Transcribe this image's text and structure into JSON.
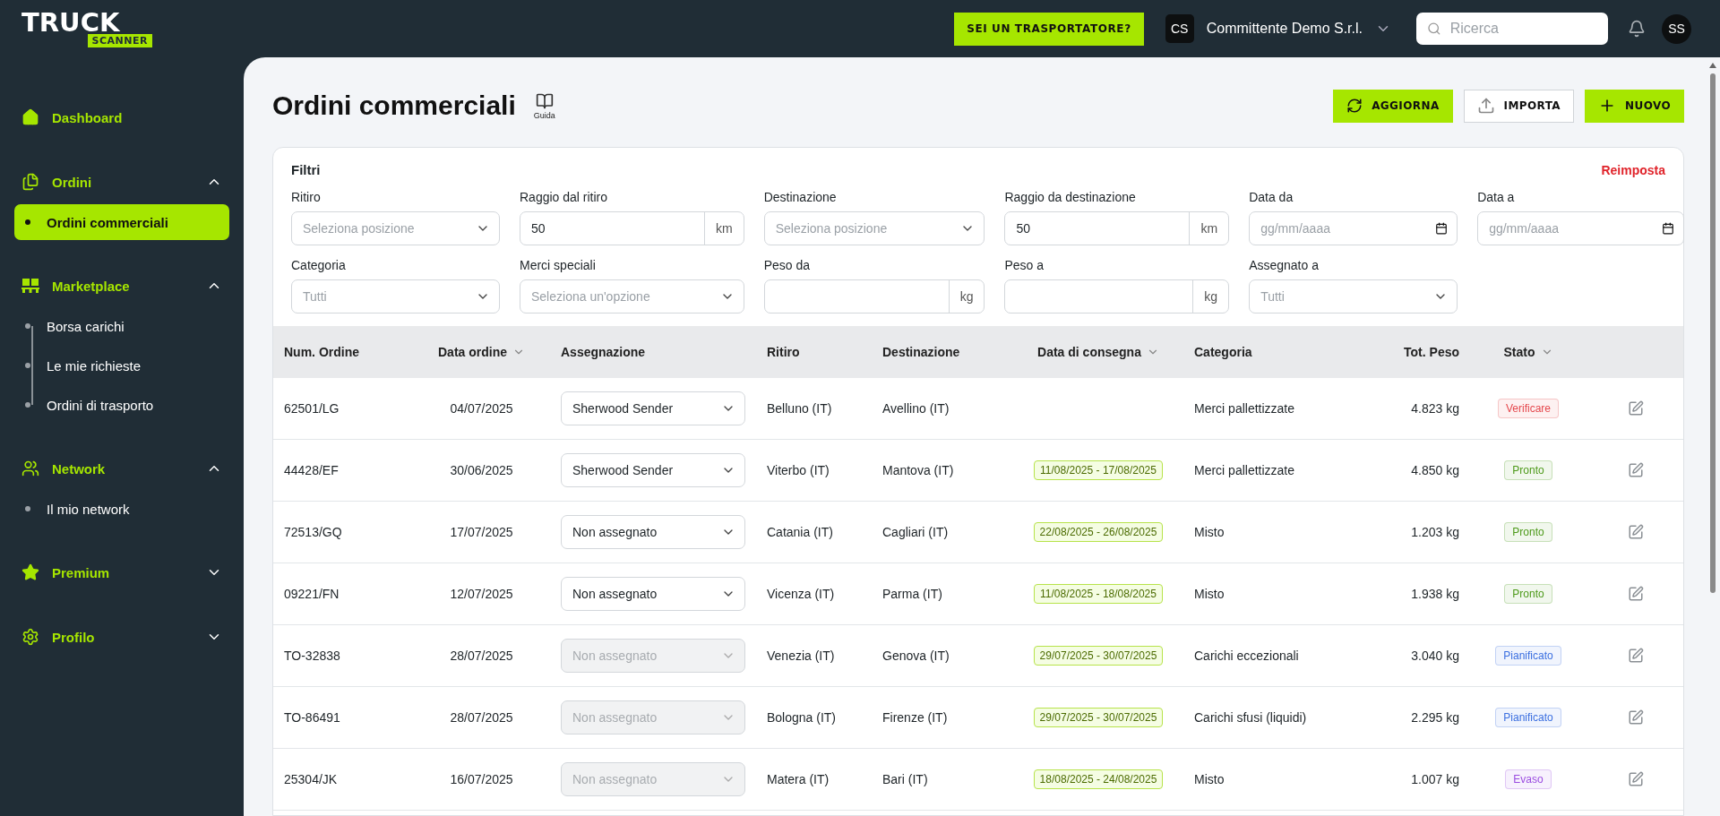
{
  "logo": {
    "word": "TRUCK",
    "tag": "SCANNER"
  },
  "topbar": {
    "carrier_button": "SEI UN TRASPORTATORE?",
    "company": {
      "initials": "CS",
      "name": "Committente Demo S.r.l."
    },
    "search": {
      "placeholder": "Ricerca"
    },
    "user_initials": "SS"
  },
  "sidebar": [
    {
      "label": "Dashboard",
      "kind": "link"
    },
    {
      "label": "Ordini",
      "kind": "group",
      "expanded": true,
      "children": [
        {
          "label": "Ordini commerciali",
          "selected": true
        }
      ]
    },
    {
      "label": "Marketplace",
      "kind": "group",
      "expanded": true,
      "children": [
        {
          "label": "Borsa carichi",
          "selected": false
        },
        {
          "label": "Le mie richieste",
          "selected": false
        },
        {
          "label": "Ordini di trasporto",
          "selected": false
        }
      ]
    },
    {
      "label": "Network",
      "kind": "group",
      "expanded": true,
      "children": [
        {
          "label": "Il mio network",
          "selected": false
        }
      ]
    },
    {
      "label": "Premium",
      "kind": "group",
      "expanded": false
    },
    {
      "label": "Profilo",
      "kind": "group",
      "expanded": false
    }
  ],
  "page": {
    "title": "Ordini commerciali",
    "guide": "Guida",
    "actions": [
      {
        "label": "AGGIORNA",
        "kind": "refresh"
      },
      {
        "label": "IMPORTA",
        "kind": "import"
      },
      {
        "label": "NUOVO",
        "kind": "new"
      }
    ]
  },
  "filters": {
    "title": "Filtri",
    "reset": "Reimposta",
    "fields": [
      {
        "label": "Ritiro",
        "kind": "select",
        "placeholder": "Seleziona posizione"
      },
      {
        "label": "Raggio dal ritiro",
        "kind": "unit",
        "value": "50",
        "unit": "km"
      },
      {
        "label": "Destinazione",
        "kind": "select",
        "placeholder": "Seleziona posizione"
      },
      {
        "label": "Raggio da destinazione",
        "kind": "unit",
        "value": "50",
        "unit": "km"
      },
      {
        "label": "Data da",
        "kind": "date",
        "placeholder": "gg/mm/aaaa"
      },
      {
        "label": "Data a",
        "kind": "date",
        "placeholder": "gg/mm/aaaa"
      },
      {
        "label": "Categoria",
        "kind": "select",
        "placeholder": "Tutti"
      },
      {
        "label": "Merci speciali",
        "kind": "select",
        "placeholder": "Seleziona un'opzione"
      },
      {
        "label": "Peso da",
        "kind": "unit",
        "unit": "kg"
      },
      {
        "label": "Peso a",
        "kind": "unit",
        "unit": "kg"
      },
      {
        "label": "Assegnato a",
        "kind": "select",
        "placeholder": "Tutti"
      }
    ]
  },
  "table": {
    "columns": [
      {
        "label": "Num. Ordine"
      },
      {
        "label": "Data ordine",
        "sortable": true
      },
      {
        "label": "Assegnazione"
      },
      {
        "label": "Ritiro"
      },
      {
        "label": "Destinazione"
      },
      {
        "label": "Data di consegna",
        "sortable": true
      },
      {
        "label": "Categoria"
      },
      {
        "label": "Tot. Peso"
      },
      {
        "label": "Stato",
        "sortable": true
      }
    ],
    "rows": [
      {
        "order": "62501/LG",
        "date": "04/07/2025",
        "assignee": {
          "value": "Sherwood Sender",
          "disabled": false
        },
        "pickup": "Belluno (IT)",
        "destination": "Avellino (IT)",
        "category": "Merci pallettizzate",
        "weight": "4.823 kg",
        "status": {
          "label": "Verificare",
          "color": "#e5484d"
        }
      },
      {
        "order": "44428/EF",
        "date": "30/06/2025",
        "assignee": {
          "value": "Sherwood Sender",
          "disabled": false
        },
        "pickup": "Viterbo (IT)",
        "destination": "Mantova (IT)",
        "delivery": "11/08/2025 - 17/08/2025",
        "category": "Merci pallettizzate",
        "weight": "4.850 kg",
        "status": {
          "label": "Pronto",
          "color": "#4d9a1a"
        }
      },
      {
        "order": "72513/GQ",
        "date": "17/07/2025",
        "assignee": {
          "value": "Non assegnato",
          "disabled": false
        },
        "pickup": "Catania (IT)",
        "destination": "Cagliari (IT)",
        "delivery": "22/08/2025 - 26/08/2025",
        "category": "Misto",
        "weight": "1.203 kg",
        "status": {
          "label": "Pronto",
          "color": "#4d9a1a"
        }
      },
      {
        "order": "09221/FN",
        "date": "12/07/2025",
        "assignee": {
          "value": "Non assegnato",
          "disabled": false
        },
        "pickup": "Vicenza (IT)",
        "destination": "Parma (IT)",
        "delivery": "11/08/2025 - 18/08/2025",
        "category": "Misto",
        "weight": "1.938 kg",
        "status": {
          "label": "Pronto",
          "color": "#4d9a1a"
        }
      },
      {
        "order": "TO-32838",
        "date": "28/07/2025",
        "assignee": {
          "value": "Non assegnato",
          "disabled": true
        },
        "pickup": "Venezia (IT)",
        "destination": "Genova (IT)",
        "delivery": "29/07/2025 - 30/07/2025",
        "category": "Carichi eccezionali",
        "weight": "3.040 kg",
        "status": {
          "label": "Pianificato",
          "color": "#3b6fe0"
        }
      },
      {
        "order": "TO-86491",
        "date": "28/07/2025",
        "assignee": {
          "value": "Non assegnato",
          "disabled": true
        },
        "pickup": "Bologna (IT)",
        "destination": "Firenze (IT)",
        "delivery": "29/07/2025 - 30/07/2025",
        "category": "Carichi sfusi (liquidi)",
        "weight": "2.295 kg",
        "status": {
          "label": "Pianificato",
          "color": "#3b6fe0"
        }
      },
      {
        "order": "25304/JK",
        "date": "16/07/2025",
        "assignee": {
          "value": "Non assegnato",
          "disabled": true
        },
        "pickup": "Matera (IT)",
        "destination": "Bari (IT)",
        "delivery": "18/08/2025 - 24/08/2025",
        "category": "Misto",
        "weight": "1.007 kg",
        "status": {
          "label": "Evaso",
          "color": "#9b4de0"
        }
      }
    ]
  }
}
